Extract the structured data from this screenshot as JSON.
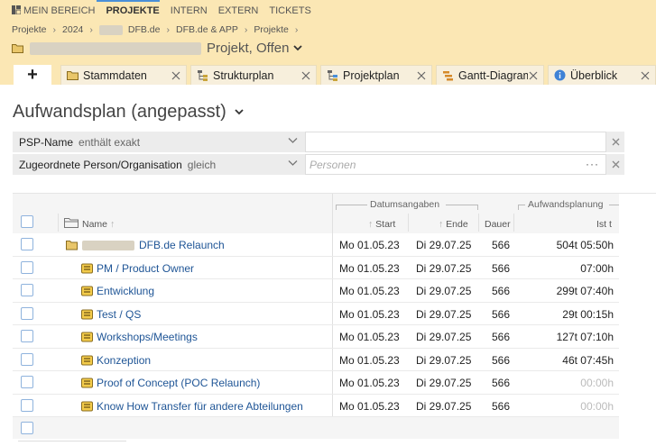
{
  "nav": {
    "items": [
      {
        "label": "MEIN BEREICH",
        "active": false
      },
      {
        "label": "PROJEKTE",
        "active": true
      },
      {
        "label": "INTERN",
        "active": false
      },
      {
        "label": "EXTERN",
        "active": false
      },
      {
        "label": "TICKETS",
        "active": false
      }
    ]
  },
  "breadcrumb": {
    "items": [
      "Projekte",
      "2024",
      "DFB.de",
      "DFB.de & APP",
      "Projekte"
    ]
  },
  "project": {
    "title_suffix": "Projekt, Offen"
  },
  "tabs": [
    {
      "label": "Stammdaten",
      "icon": "folder-icon"
    },
    {
      "label": "Strukturplan",
      "icon": "structure-icon"
    },
    {
      "label": "Projektplan",
      "icon": "plan-icon"
    },
    {
      "label": "Gantt-Diagramm",
      "icon": "gantt-icon"
    },
    {
      "label": "Überblick",
      "icon": "info-icon"
    }
  ],
  "add_tab_label": "+",
  "page": {
    "title": "Aufwandsplan (angepasst)"
  },
  "filters": [
    {
      "field": "PSP-Name",
      "operator": "enthält exakt",
      "value": "",
      "placeholder": ""
    },
    {
      "field": "Zugeordnete Person/Organisation",
      "operator": "gleich",
      "value": "",
      "placeholder": "Personen",
      "more_label": "···"
    }
  ],
  "table": {
    "groups": {
      "dates": "Datumsangaben",
      "effort": "Aufwandsplanung"
    },
    "columns": {
      "name": "Name",
      "start": "Start",
      "end": "Ende",
      "duration": "Dauer",
      "ist": "Ist t"
    },
    "rows": [
      {
        "name": "DFB.de Relaunch",
        "type": "project",
        "start": "Mo 01.05.23",
        "end": "Di 29.07.25",
        "duration": "566",
        "ist": "504t 05:50h"
      },
      {
        "name": "PM / Product Owner",
        "type": "task",
        "start": "Mo 01.05.23",
        "end": "Di 29.07.25",
        "duration": "566",
        "ist": "07:00h"
      },
      {
        "name": "Entwicklung",
        "type": "task",
        "start": "Mo 01.05.23",
        "end": "Di 29.07.25",
        "duration": "566",
        "ist": "299t 07:40h"
      },
      {
        "name": "Test / QS",
        "type": "task",
        "start": "Mo 01.05.23",
        "end": "Di 29.07.25",
        "duration": "566",
        "ist": "29t 00:15h"
      },
      {
        "name": "Workshops/Meetings",
        "type": "task",
        "start": "Mo 01.05.23",
        "end": "Di 29.07.25",
        "duration": "566",
        "ist": "127t 07:10h"
      },
      {
        "name": "Konzeption",
        "type": "task",
        "start": "Mo 01.05.23",
        "end": "Di 29.07.25",
        "duration": "566",
        "ist": "46t 07:45h"
      },
      {
        "name": "Proof of Concept (POC Relaunch)",
        "type": "task",
        "start": "Mo 01.05.23",
        "end": "Di 29.07.25",
        "duration": "566",
        "ist": "00:00h"
      },
      {
        "name": "Know How Transfer für andere Abteilungen",
        "type": "task",
        "start": "Mo 01.05.23",
        "end": "Di 29.07.25",
        "duration": "566",
        "ist": "00:00h"
      }
    ]
  },
  "colors": {
    "header_bg": "#fbe7b4",
    "link": "#1f5596",
    "accent": "#4a8fd8"
  }
}
